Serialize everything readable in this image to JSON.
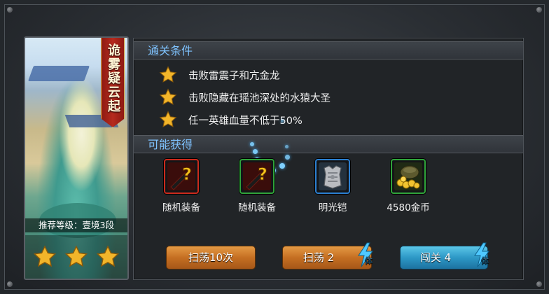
{
  "stage": {
    "name": "诡雾疑云起",
    "recommend": "推荐等级：壹境3段",
    "stars": 3
  },
  "conditions": {
    "title": "通关条件",
    "items": [
      "击败雷震子和亢金龙",
      "击败隐藏在瑶池深处的水猿大圣",
      "任一英雄血量不低于50%"
    ]
  },
  "rewards": {
    "title": "可能获得",
    "items": [
      {
        "label": "随机装备",
        "icon": "random-equipment-icon",
        "border": "#cc2a1c"
      },
      {
        "label": "随机装备",
        "icon": "random-equipment-icon",
        "border": "#2fa33a"
      },
      {
        "label": "明光铠",
        "icon": "armor-icon",
        "border": "#2b7fd0"
      },
      {
        "label": "4580金币",
        "icon": "gold-coins-icon",
        "border": "#2fa33a"
      }
    ]
  },
  "buttons": {
    "sweep10": "扫荡10次",
    "sweep": "扫荡 2",
    "challenge": "闯关 4",
    "stamina_tag": "体"
  },
  "colors": {
    "section_title": "#7fc3ff",
    "star": "#f2b52a",
    "orange_button": "#c56f22",
    "blue_button": "#2d98c6"
  }
}
